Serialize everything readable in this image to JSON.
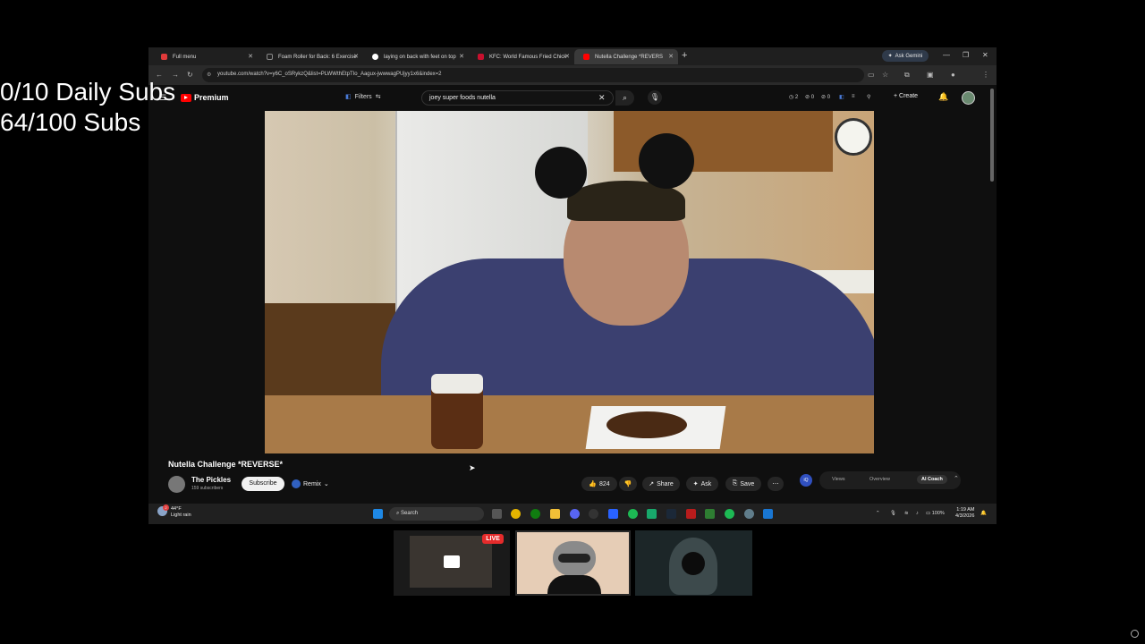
{
  "overlay": {
    "daily_subs": "0/10 Daily Subs",
    "subs": "64/100 Subs"
  },
  "browser": {
    "tabs": [
      {
        "label": "Full menu",
        "active": false
      },
      {
        "label": "Foam Roller for Back: 6 Exercise",
        "active": false
      },
      {
        "label": "laying on back with feet on top",
        "active": false
      },
      {
        "label": "KFC: World Famous Fried Chick",
        "active": false
      },
      {
        "label": "Nutella Challenge *REVERS",
        "active": true
      }
    ],
    "ask_gemini": "Ask Gemini",
    "url": "youtube.com/watch?v=y6C_oSRykzQ&list=PLWWthEtpTIo_Aagux-jwwwagPUjyy1x6&index=2"
  },
  "youtube": {
    "logo_text": "Premium",
    "filters_label": "Filters",
    "search_value": "joey super foods nutella",
    "header_stats": [
      "2",
      "0",
      "0"
    ],
    "create_label": "Create",
    "video_title": "Nutella Challenge *REVERSE*",
    "channel_name": "The Pickles",
    "channel_subs": "159 subscribers",
    "subscribe_label": "Subscribe",
    "remix_label": "Remix",
    "like_count": "824",
    "share_label": "Share",
    "ask_label": "Ask",
    "save_label": "Save",
    "ai_tabs": [
      "Views",
      "Overview",
      "AI Coach"
    ]
  },
  "taskbar": {
    "weather_temp": "44°F",
    "weather_desc": "Light rain",
    "weather_badge": "2",
    "search_label": "Search",
    "battery": "100%",
    "time": "1:19 AM",
    "date": "4/3/2026"
  },
  "stream": {
    "live_label": "LIVE"
  },
  "colors": {
    "youtube_red": "#ff0000",
    "live_red": "#e52b2b",
    "accent_blue": "#3060c0"
  }
}
